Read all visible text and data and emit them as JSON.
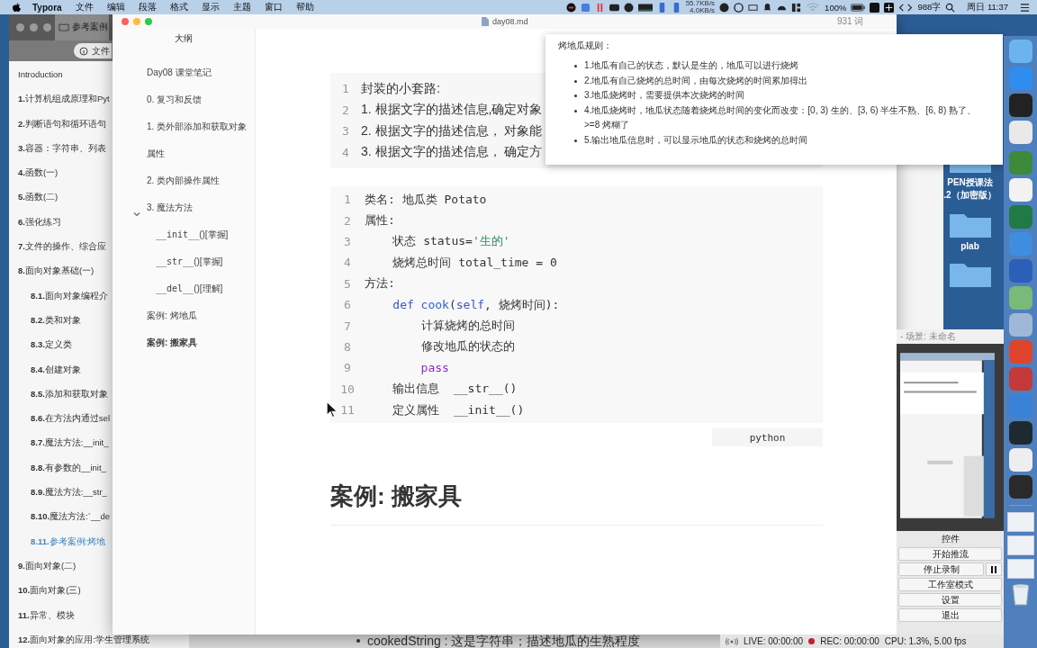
{
  "menu_bar": {
    "app": "Typora",
    "menus": [
      "文件",
      "编辑",
      "段落",
      "格式",
      "显示",
      "主题",
      "窗口",
      "帮助"
    ],
    "net_up": "55.7KB/s",
    "net_down": "4.0KB/s",
    "battery": "100%",
    "word_count": "988字",
    "clock": "周日 11:37"
  },
  "browser": {
    "tab": "参考案例",
    "address": "文件",
    "toc": [
      {
        "title": "Introduction",
        "selected": false
      },
      {
        "number": "1.",
        "title": "计算机组成原理和Pyt",
        "selected": false
      },
      {
        "number": "2.",
        "title": "判断语句和循环语句",
        "selected": false
      },
      {
        "number": "3.",
        "title": "容器：字符串、列表",
        "selected": false
      },
      {
        "number": "4.",
        "title": "函数(一)",
        "selected": false
      },
      {
        "number": "5.",
        "title": "函数(二)",
        "selected": false
      },
      {
        "number": "6.",
        "title": "强化练习",
        "selected": false
      },
      {
        "number": "7.",
        "title": "文件的操作、综合应",
        "selected": false
      },
      {
        "number": "8.",
        "title": "面向对象基础(一)",
        "selected": false,
        "children": [
          {
            "number": "8.1.",
            "title": "面向对象编程介",
            "selected": false
          },
          {
            "number": "8.2.",
            "title": "类和对象",
            "selected": false
          },
          {
            "number": "8.3.",
            "title": "定义类",
            "selected": false
          },
          {
            "number": "8.4.",
            "title": "创建对象",
            "selected": false
          },
          {
            "number": "8.5.",
            "title": "添加和获取对象",
            "selected": false
          },
          {
            "number": "8.6.",
            "title": "在方法内通过sel",
            "selected": false
          },
          {
            "number": "8.7.",
            "title": "魔法方法:__init_",
            "selected": false
          },
          {
            "number": "8.8.",
            "title": "有参数的__init_",
            "selected": false
          },
          {
            "number": "8.9.",
            "title": "魔法方法:__str_",
            "selected": false
          },
          {
            "number": "8.10.",
            "title": "魔法方法:`__de",
            "selected": false
          },
          {
            "number": "8.11.",
            "title": "参考案例:烤地",
            "selected": true
          }
        ]
      },
      {
        "number": "9.",
        "title": "面向对象(二)",
        "selected": false
      },
      {
        "number": "10.",
        "title": "面向对象(三)",
        "selected": false
      },
      {
        "number": "11.",
        "title": "异常、模块",
        "selected": false
      },
      {
        "number": "12.",
        "title": "面向对象的应用:学生管理系统",
        "selected": false
      }
    ],
    "bullet": "cookedString : 这是字符串；描述地瓜的生熟程度"
  },
  "typora": {
    "filename": "day08.md",
    "word_count": "931 词",
    "outline_title": "大纲",
    "outline": [
      {
        "text": "Day08 课堂笔记",
        "selected": false
      },
      {
        "text": "0. 复习和反馈",
        "selected": false
      },
      {
        "text": "1. 类外部添加和获取对象属性",
        "selected": false
      },
      {
        "text": "2. 类内部操作属性",
        "selected": false
      },
      {
        "text": "3. 魔法方法",
        "selected": false,
        "expanded": true,
        "children": [
          {
            "code": "__init__",
            "text": "()[掌握]",
            "selected": false
          },
          {
            "code": "__str__",
            "text": "()[掌握]",
            "selected": false
          },
          {
            "code": "__del__",
            "text": "()[理解]",
            "selected": false
          }
        ]
      },
      {
        "text": "案例: 烤地瓜",
        "selected": false
      },
      {
        "text": "案例: 搬家具",
        "selected": true
      }
    ],
    "steps": [
      {
        "number": "1",
        "text": "封装的小套路:"
      },
      {
        "number": "2",
        "text": "1. 根据文字的描述信息,确定对象"
      },
      {
        "number": "3",
        "text": "2. 根据文字的描述信息， 对象能"
      },
      {
        "number": "4",
        "text": "3. 根据文字的描述信息， 确定方"
      }
    ],
    "code": [
      {
        "number": "1",
        "tokens": [
          {
            "kind": "plain",
            "text": "类名: 地瓜类 Potato"
          }
        ]
      },
      {
        "number": "2",
        "tokens": [
          {
            "kind": "plain",
            "text": "属性:"
          }
        ]
      },
      {
        "number": "3",
        "tokens": [
          {
            "kind": "plain",
            "text": "    状态 status="
          },
          {
            "kind": "string",
            "text": "'生的'"
          }
        ]
      },
      {
        "number": "4",
        "tokens": [
          {
            "kind": "plain",
            "text": "    烧烤总时间 total_time = 0"
          }
        ]
      },
      {
        "number": "5",
        "tokens": [
          {
            "kind": "plain",
            "text": "方法:"
          }
        ]
      },
      {
        "number": "6",
        "tokens": [
          {
            "kind": "keyword",
            "text": "    def"
          },
          {
            "kind": "func",
            "text": " cook"
          },
          {
            "kind": "plain",
            "text": "("
          },
          {
            "kind": "keyword",
            "text": "self"
          },
          {
            "kind": "plain",
            "text": ", 烧烤时间):"
          }
        ]
      },
      {
        "number": "7",
        "tokens": [
          {
            "kind": "plain",
            "text": "        计算烧烤的总时间"
          }
        ]
      },
      {
        "number": "8",
        "tokens": [
          {
            "kind": "plain",
            "text": "        修改地瓜的状态的"
          }
        ]
      },
      {
        "number": "9",
        "tokens": [
          {
            "kind": "control",
            "text": "        pass"
          }
        ]
      },
      {
        "number": "10",
        "tokens": [
          {
            "kind": "plain",
            "text": "    输出信息  __str__()"
          }
        ]
      },
      {
        "number": "11",
        "tokens": [
          {
            "kind": "plain",
            "text": "    定义属性  __init__()"
          }
        ]
      }
    ],
    "language": "python",
    "heading": "案例: 搬家具"
  },
  "tooltip": {
    "title": "烤地瓜规则：",
    "items": [
      "1.地瓜有自己的状态，默认是生的，地瓜可以进行烧烤",
      "2.地瓜有自己烧烤的总时间，由每次烧烤的时间累加得出",
      "3.地瓜烧烤时，需要提供本次烧烤的时间",
      "4.地瓜烧烤时，地瓜状态随着烧烤总时间的变化而改变：[0, 3) 生的、[3, 6) 半生不熟、[6, 8) 熟了、>=8 烤糊了",
      "5.输出地瓜信息时，可以显示地瓜的状态和烧烤的总时间"
    ]
  },
  "desktop": {
    "folders": [
      {
        "label": "PEN授课法\n.2（加密版）"
      },
      {
        "label": "plab"
      }
    ]
  },
  "obs": {
    "title": "- 场景: 未命名",
    "controls_title": "控件",
    "buttons": [
      {
        "label": "开始推流"
      },
      {
        "label": "停止录制",
        "pause": true
      },
      {
        "label": "工作室模式"
      },
      {
        "label": "设置"
      },
      {
        "label": "退出"
      }
    ],
    "live": "LIVE: 00:00:00",
    "rec": "REC: 00:00:00",
    "cpu": "CPU: 1.3%, 5.00 fps"
  }
}
